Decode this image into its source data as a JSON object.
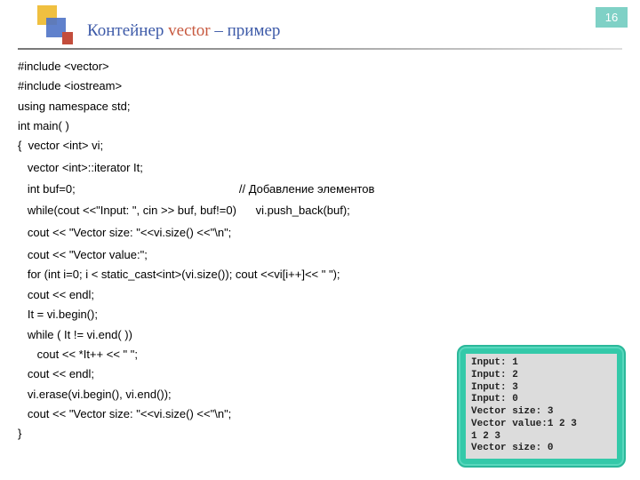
{
  "page_number": "16",
  "title": {
    "part1": "Контейнер ",
    "part2": "vector",
    "part3": " – пример"
  },
  "code": {
    "l01": "#include <vector>",
    "l02": "#include <iostream>",
    "l03": "using namespace std;",
    "l04": "int main( )",
    "l05": "{  vector <int> vi;",
    "l06": "   vector <int>::iterator It;",
    "l07": "   int buf=0;                                                   // Добавление элементов",
    "l08": "   while(cout <<\"Input: \", cin >> buf, buf!=0)      vi.push_back(buf);",
    "l09": "   cout << \"Vector size: \"<<vi.size() <<\"\\n\";",
    "l10": "   cout << \"Vector value:\";",
    "l11": "   for (int i=0; i < static_cast<int>(vi.size()); cout <<vi[i++]<< \" \");",
    "l12": "   cout << endl;",
    "l13": "   It = vi.begin();",
    "l14": "   while ( It != vi.end( ))",
    "l15": "      cout << *It++ << \" \";",
    "l16": "   cout << endl;",
    "l17": "   vi.erase(vi.begin(), vi.end());",
    "l18": "   cout << \"Vector size: \"<<vi.size() <<\"\\n\";",
    "l19": "}"
  },
  "output": "Input: 1\nInput: 2\nInput: 3\nInput: 0\nVector size: 3\nVector value:1 2 3\n1 2 3\nVector size: 0"
}
